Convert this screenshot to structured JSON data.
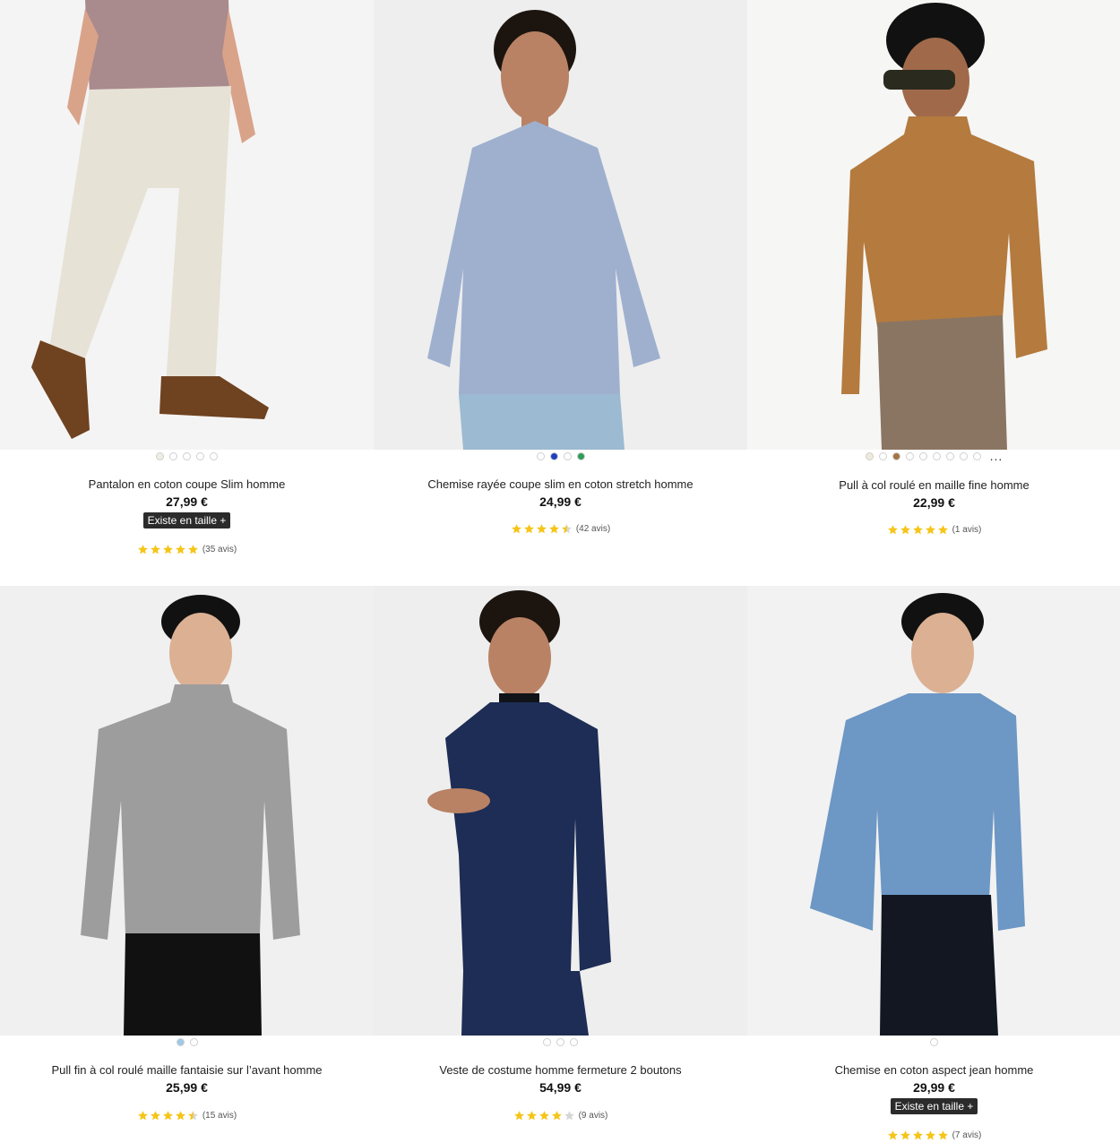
{
  "products": [
    {
      "title": "Pantalon en coton coupe Slim homme",
      "price": "27,99 €",
      "size_badge": "Existe en taille +",
      "rating": 5,
      "reviews": "(35 avis)",
      "swatches": [
        "#efeee4",
        "#ffffff",
        "#ffffff",
        "#ffffff",
        "#ffffff"
      ],
      "more": "",
      "colors": {
        "bg": "#f4f4f4",
        "top": "#a98a8d",
        "bottom": "#e7e2d6",
        "shoe": "#6f4220",
        "skin": "#d9a38a"
      }
    },
    {
      "title": "Chemise rayée coupe slim en coton stretch homme",
      "price": "24,99 €",
      "size_badge": "",
      "rating": 4.5,
      "reviews": "(42 avis)",
      "swatches": [
        "#ffffff",
        "#1f3fbf",
        "#ffffff",
        "#2c9e5a"
      ],
      "more": "",
      "colors": {
        "bg": "#eeeeee",
        "top": "#9fb0cf",
        "bottom": "#9cbad1",
        "hair": "#1c140f",
        "skin": "#b98264"
      }
    },
    {
      "title": "Pull à col roulé en maille fine homme",
      "price": "22,99 €",
      "size_badge": "",
      "rating": 5,
      "reviews": "(1 avis)",
      "swatches": [
        "#efeadc",
        "#ffffff",
        "#a37443",
        "#ffffff",
        "#ffffff",
        "#ffffff",
        "#ffffff",
        "#ffffff",
        "#ffffff"
      ],
      "more": "...",
      "colors": {
        "bg": "#f6f6f4",
        "top": "#b47a3e",
        "bottom": "#8a7563",
        "hair": "#111111",
        "skin": "#a06a4a"
      }
    },
    {
      "title": "Pull fin à col roulé maille fantaisie sur l’avant homme",
      "price": "25,99 €",
      "size_badge": "",
      "rating": 4.5,
      "reviews": "(15 avis)",
      "swatches": [
        "#9ec8e6",
        "#ffffff"
      ],
      "more": "",
      "colors": {
        "bg": "#f0f0f0",
        "top": "#9d9d9d",
        "bottom": "#111111",
        "hair": "#111111",
        "skin": "#dcb093"
      }
    },
    {
      "title": "Veste de costume homme fermeture 2 boutons",
      "price": "54,99 €",
      "size_badge": "",
      "rating": 4,
      "reviews": "(9 avis)",
      "swatches": [
        "#ffffff",
        "#ffffff",
        "#ffffff"
      ],
      "more": "",
      "colors": {
        "bg": "#eeeeee",
        "top": "#1e2d55",
        "bottom": "#1e2d55",
        "hair": "#1c140f",
        "skin": "#b98264"
      }
    },
    {
      "title": "Chemise en coton aspect jean homme",
      "price": "29,99 €",
      "size_badge": "Existe en taille +",
      "rating": 5,
      "reviews": "(7 avis)",
      "swatches": [
        "#ffffff"
      ],
      "more": "",
      "colors": {
        "bg": "#f2f2f2",
        "top": "#6d97c4",
        "bottom": "#121722",
        "hair": "#111111",
        "skin": "#dcb093"
      }
    }
  ],
  "star_colors": {
    "filled": "#f5c518",
    "empty": "#d6d6d6"
  }
}
